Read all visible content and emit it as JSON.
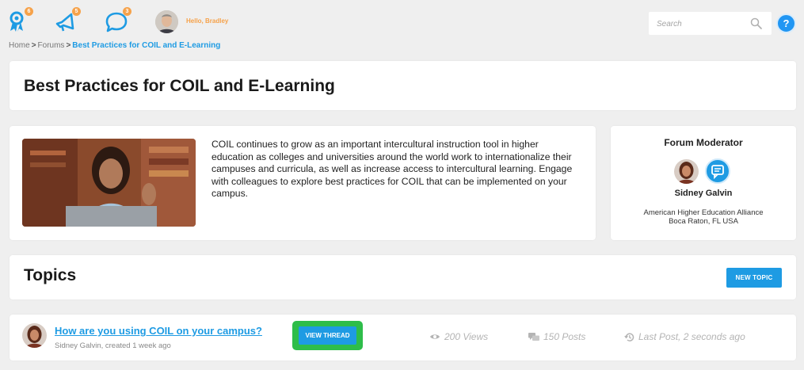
{
  "header": {
    "nav_icons": [
      {
        "icon": "award-ribbon-icon",
        "badge": "6"
      },
      {
        "icon": "megaphone-icon",
        "badge": "5"
      },
      {
        "icon": "chat-bubble-icon",
        "badge": "3"
      }
    ],
    "greeting": "Hello, Bradley",
    "search": {
      "placeholder": "Search",
      "value": ""
    },
    "help_label": "?"
  },
  "breadcrumb": {
    "home": "Home",
    "forums": "Forums",
    "current": "Best Practices for COIL and E-Learning",
    "separator": ">"
  },
  "forum": {
    "title": "Best Practices for COIL and E-Learning",
    "description": "COIL continues to grow as an important intercultural instruction tool in higher education as colleges and universities around the world work to internationalize their campuses and curricula, as well as increase access to intercultural learning. Engage with colleagues to explore best practices for COIL that can be implemented on your campus."
  },
  "moderator": {
    "heading": "Forum Moderator",
    "name": "Sidney Galvin",
    "org": "American Higher Education Alliance",
    "location": "Boca Raton, FL USA"
  },
  "topics": {
    "heading": "Topics",
    "new_topic_label": "NEW TOPIC",
    "threads": [
      {
        "title": "How are you using COIL on your campus?",
        "meta": "Sidney Galvin, created 1 week ago",
        "view_label": "VIEW THREAD",
        "views": "200 Views",
        "posts": "150 Posts",
        "last_post": "Last Post, 2 seconds ago"
      }
    ]
  },
  "colors": {
    "accent": "#1e9be3",
    "badge": "#f6a24a",
    "highlight": "#2ebd4a",
    "background": "#efefef"
  }
}
